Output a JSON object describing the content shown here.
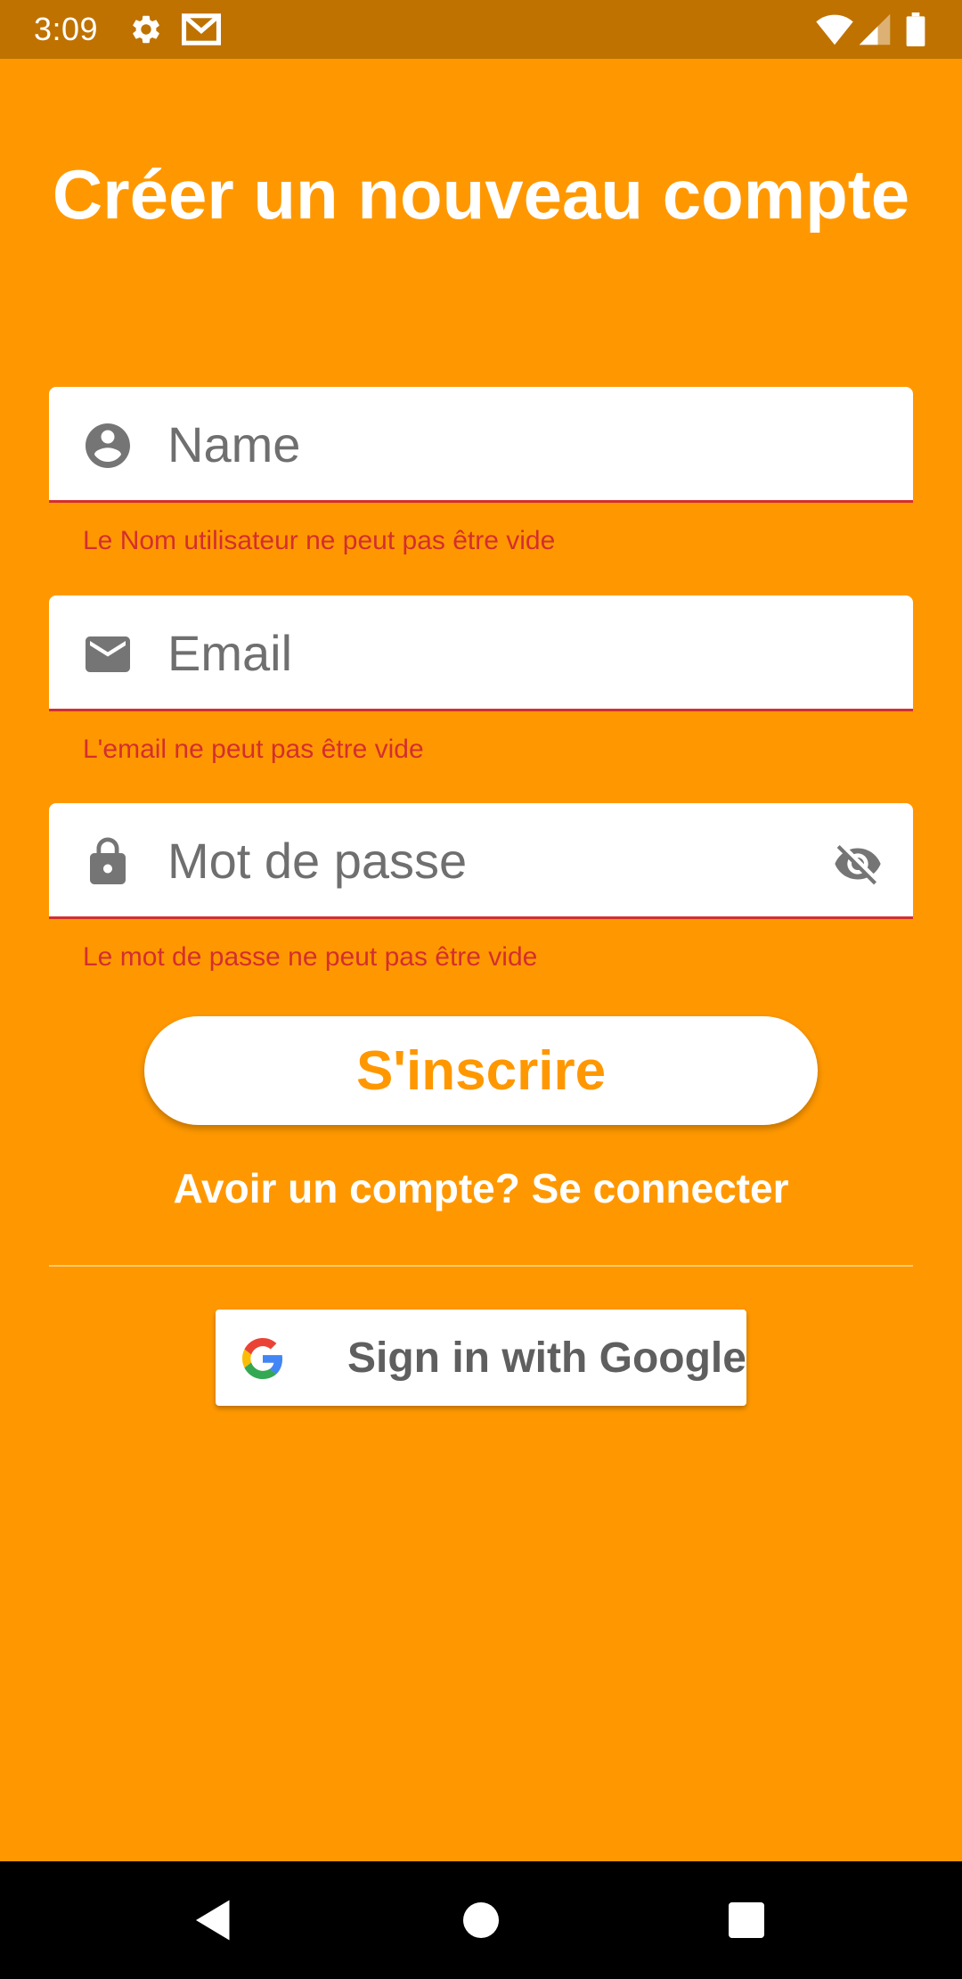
{
  "status_bar": {
    "time": "3:09",
    "icons": [
      "gear-icon",
      "gmail-icon",
      "wifi-icon",
      "signal-icon",
      "battery-icon"
    ]
  },
  "colors": {
    "background": "#FF9800",
    "status_bar": "#BF7200",
    "error": "#D32F2F",
    "field_icon": "#757575"
  },
  "page": {
    "title": "Créer un nouveau compte"
  },
  "form": {
    "name": {
      "icon": "account-circle-icon",
      "placeholder": "Name",
      "value": "",
      "error": "Le Nom utilisateur ne peut pas être vide"
    },
    "email": {
      "icon": "mail-icon",
      "placeholder": "Email",
      "value": "",
      "error": "L'email ne peut pas être vide"
    },
    "password": {
      "icon": "lock-icon",
      "trailing_icon": "visibility-off-icon",
      "placeholder": "Mot de passe",
      "value": "",
      "error": "Le mot de passe ne peut pas être vide"
    },
    "submit_label": "S'inscrire",
    "login_link": "Avoir un compte? Se connecter"
  },
  "google": {
    "icon": "google-logo-icon",
    "label": "Sign in with Google"
  },
  "nav_bar": {
    "buttons": [
      "back-icon",
      "home-icon",
      "recents-icon"
    ]
  }
}
